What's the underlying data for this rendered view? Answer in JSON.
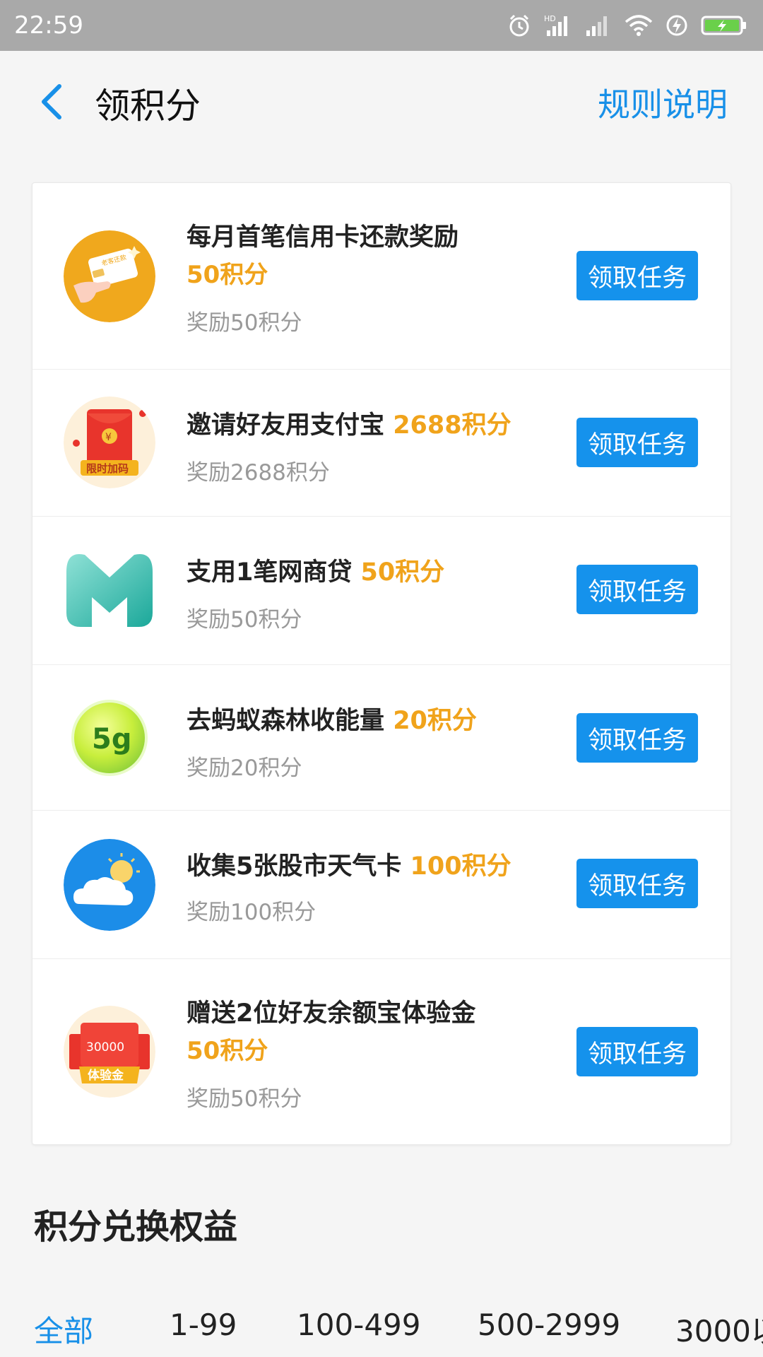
{
  "status_bar": {
    "time": "22:59",
    "network_badge": "HD"
  },
  "header": {
    "title": "领积分",
    "rules_label": "规则说明"
  },
  "tasks": [
    {
      "title": "每月首笔信用卡还款奖励",
      "points": "50积分",
      "reward": "奖励50积分",
      "button": "领取任务",
      "icon": "credit-card-icon",
      "icon_text": "老客还款"
    },
    {
      "title": "邀请好友用支付宝",
      "points": "2688积分",
      "reward": "奖励2688积分",
      "button": "领取任务",
      "icon": "red-envelope-icon",
      "icon_text": "限时加码"
    },
    {
      "title": "支用1笔网商贷",
      "points": "50积分",
      "reward": "奖励50积分",
      "button": "领取任务",
      "icon": "mybank-logo-icon"
    },
    {
      "title": "去蚂蚁森林收能量",
      "points": "20积分",
      "reward": "奖励20积分",
      "button": "领取任务",
      "icon": "green-energy-icon",
      "icon_text": "5g"
    },
    {
      "title": "收集5张股市天气卡",
      "points": "100积分",
      "reward": "奖励100积分",
      "button": "领取任务",
      "icon": "weather-cloud-icon"
    },
    {
      "title": "赠送2位好友余额宝体验金",
      "points": "50积分",
      "reward": "奖励50积分",
      "button": "领取任务",
      "icon": "experience-fund-icon",
      "icon_text": "体验金",
      "icon_amount": "30000"
    }
  ],
  "exchange": {
    "title": "积分兑换权益",
    "tabs": [
      "全部",
      "1-99",
      "100-499",
      "500-2999",
      "3000以"
    ]
  },
  "colors": {
    "accent": "#1890e8",
    "button": "#1592ec",
    "points": "#f0a31b"
  }
}
